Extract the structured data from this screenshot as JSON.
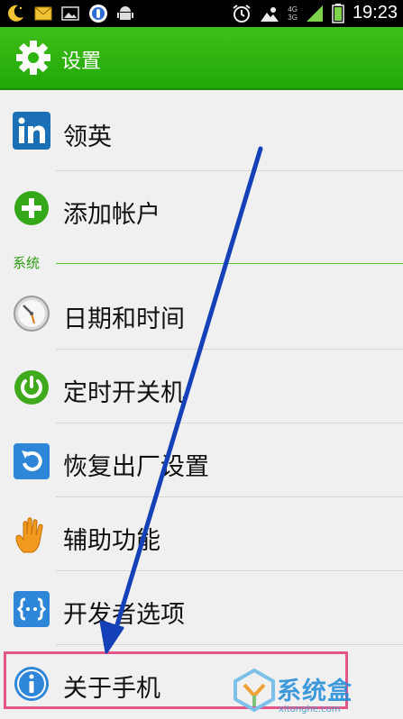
{
  "status_bar": {
    "time": "19:23",
    "network_labels": [
      "4G",
      "3G"
    ],
    "icons": [
      "moon-icon",
      "mail-icon",
      "image-icon",
      "sync-icon",
      "android-icon",
      "alarm-icon",
      "weather-icon",
      "signal-icon",
      "battery-icon"
    ]
  },
  "action_bar": {
    "title": "设置",
    "icon": "gear-icon",
    "color": "#2db50f"
  },
  "settings": {
    "items": [
      {
        "label": "领英",
        "icon": "linkedin-icon"
      },
      {
        "label": "添加帐户",
        "icon": "add-icon"
      }
    ],
    "system_section": {
      "title": "系统",
      "items": [
        {
          "label": "日期和时间",
          "icon": "clock-icon"
        },
        {
          "label": "定时开关机",
          "icon": "power-icon"
        },
        {
          "label": "恢复出厂设置",
          "icon": "restore-icon"
        },
        {
          "label": "辅助功能",
          "icon": "hand-icon"
        },
        {
          "label": "开发者选项",
          "icon": "developer-icon"
        },
        {
          "label": "关于手机",
          "icon": "info-icon",
          "highlighted": true
        }
      ]
    }
  },
  "annotation": {
    "arrow_color": "#1440b8",
    "highlight_color": "#e3568a"
  },
  "watermark": {
    "text": "系统盒",
    "url": "xitonghe.com"
  }
}
